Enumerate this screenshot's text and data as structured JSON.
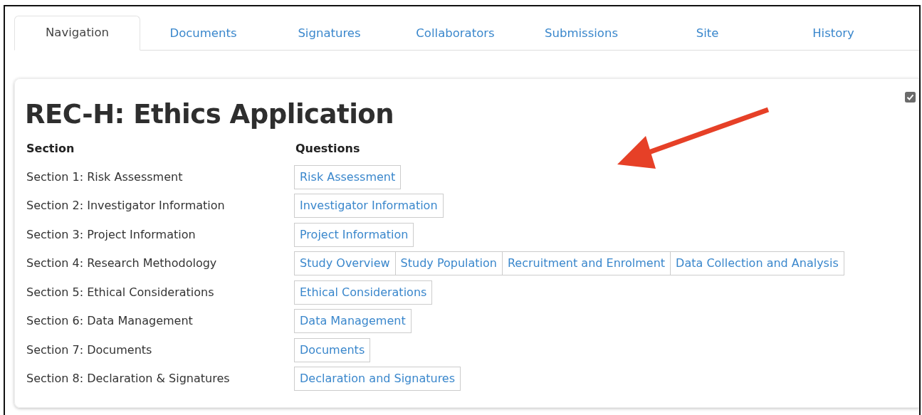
{
  "tabs": [
    {
      "label": "Navigation",
      "selected": true
    },
    {
      "label": "Documents",
      "selected": false
    },
    {
      "label": "Signatures",
      "selected": false
    },
    {
      "label": "Collaborators",
      "selected": false
    },
    {
      "label": "Submissions",
      "selected": false
    },
    {
      "label": "Site",
      "selected": false
    },
    {
      "label": "History",
      "selected": false
    }
  ],
  "card": {
    "title": "REC-H: Ethics Application",
    "checkbox": {
      "checked": true
    },
    "annotation": {
      "kind": "arrow"
    },
    "table": {
      "columns": [
        "Section",
        "Questions"
      ],
      "rows": [
        {
          "section": "Section 1: Risk Assessment",
          "questions": [
            "Risk Assessment"
          ]
        },
        {
          "section": "Section 2: Investigator Information",
          "questions": [
            "Investigator Information"
          ]
        },
        {
          "section": "Section 3: Project Information",
          "questions": [
            "Project Information"
          ]
        },
        {
          "section": "Section 4: Research Methodology",
          "questions": [
            "Study Overview",
            "Study Population",
            "Recruitment and Enrolment",
            "Data Collection and Analysis"
          ]
        },
        {
          "section": "Section 5: Ethical Considerations",
          "questions": [
            "Ethical Considerations"
          ]
        },
        {
          "section": "Section 6: Data Management",
          "questions": [
            "Data Management"
          ]
        },
        {
          "section": "Section 7: Documents",
          "questions": [
            "Documents"
          ]
        },
        {
          "section": "Section 8: Declaration & Signatures",
          "questions": [
            "Declaration and Signatures"
          ]
        }
      ]
    }
  }
}
